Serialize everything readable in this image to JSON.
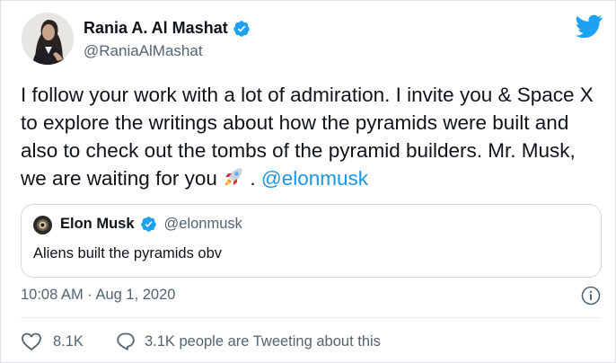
{
  "author": {
    "name": "Rania A. Al Mashat",
    "handle": "@RaniaAlMashat",
    "verified": true,
    "avatar_icon": "profile-photo"
  },
  "brand_icon": "twitter-bird-icon",
  "colors": {
    "twitter_blue": "#1da1f2",
    "mention": "#1b95e0",
    "text": "#0f1419",
    "muted": "#536471",
    "border": "#cfd9de"
  },
  "tweet": {
    "text_main": "I follow your work with a lot of admiration. I invite you & Space X to explore the writings about how the pyramids were built and also to check out the tombs of the pyramid builders. Mr. Musk, we are waiting for you",
    "emoji": "rocket",
    "text_after_emoji": " . ",
    "mention": "@elonmusk"
  },
  "quoted_tweet": {
    "name": "Elon Musk",
    "handle": "@elonmusk",
    "verified": true,
    "text": "Aliens built the pyramids obv"
  },
  "meta": {
    "timestamp": "10:08 AM · Aug 1, 2020",
    "info_icon": "info-icon"
  },
  "actions": {
    "likes": "8.1K",
    "conversation": "3.1K people are Tweeting about this"
  }
}
